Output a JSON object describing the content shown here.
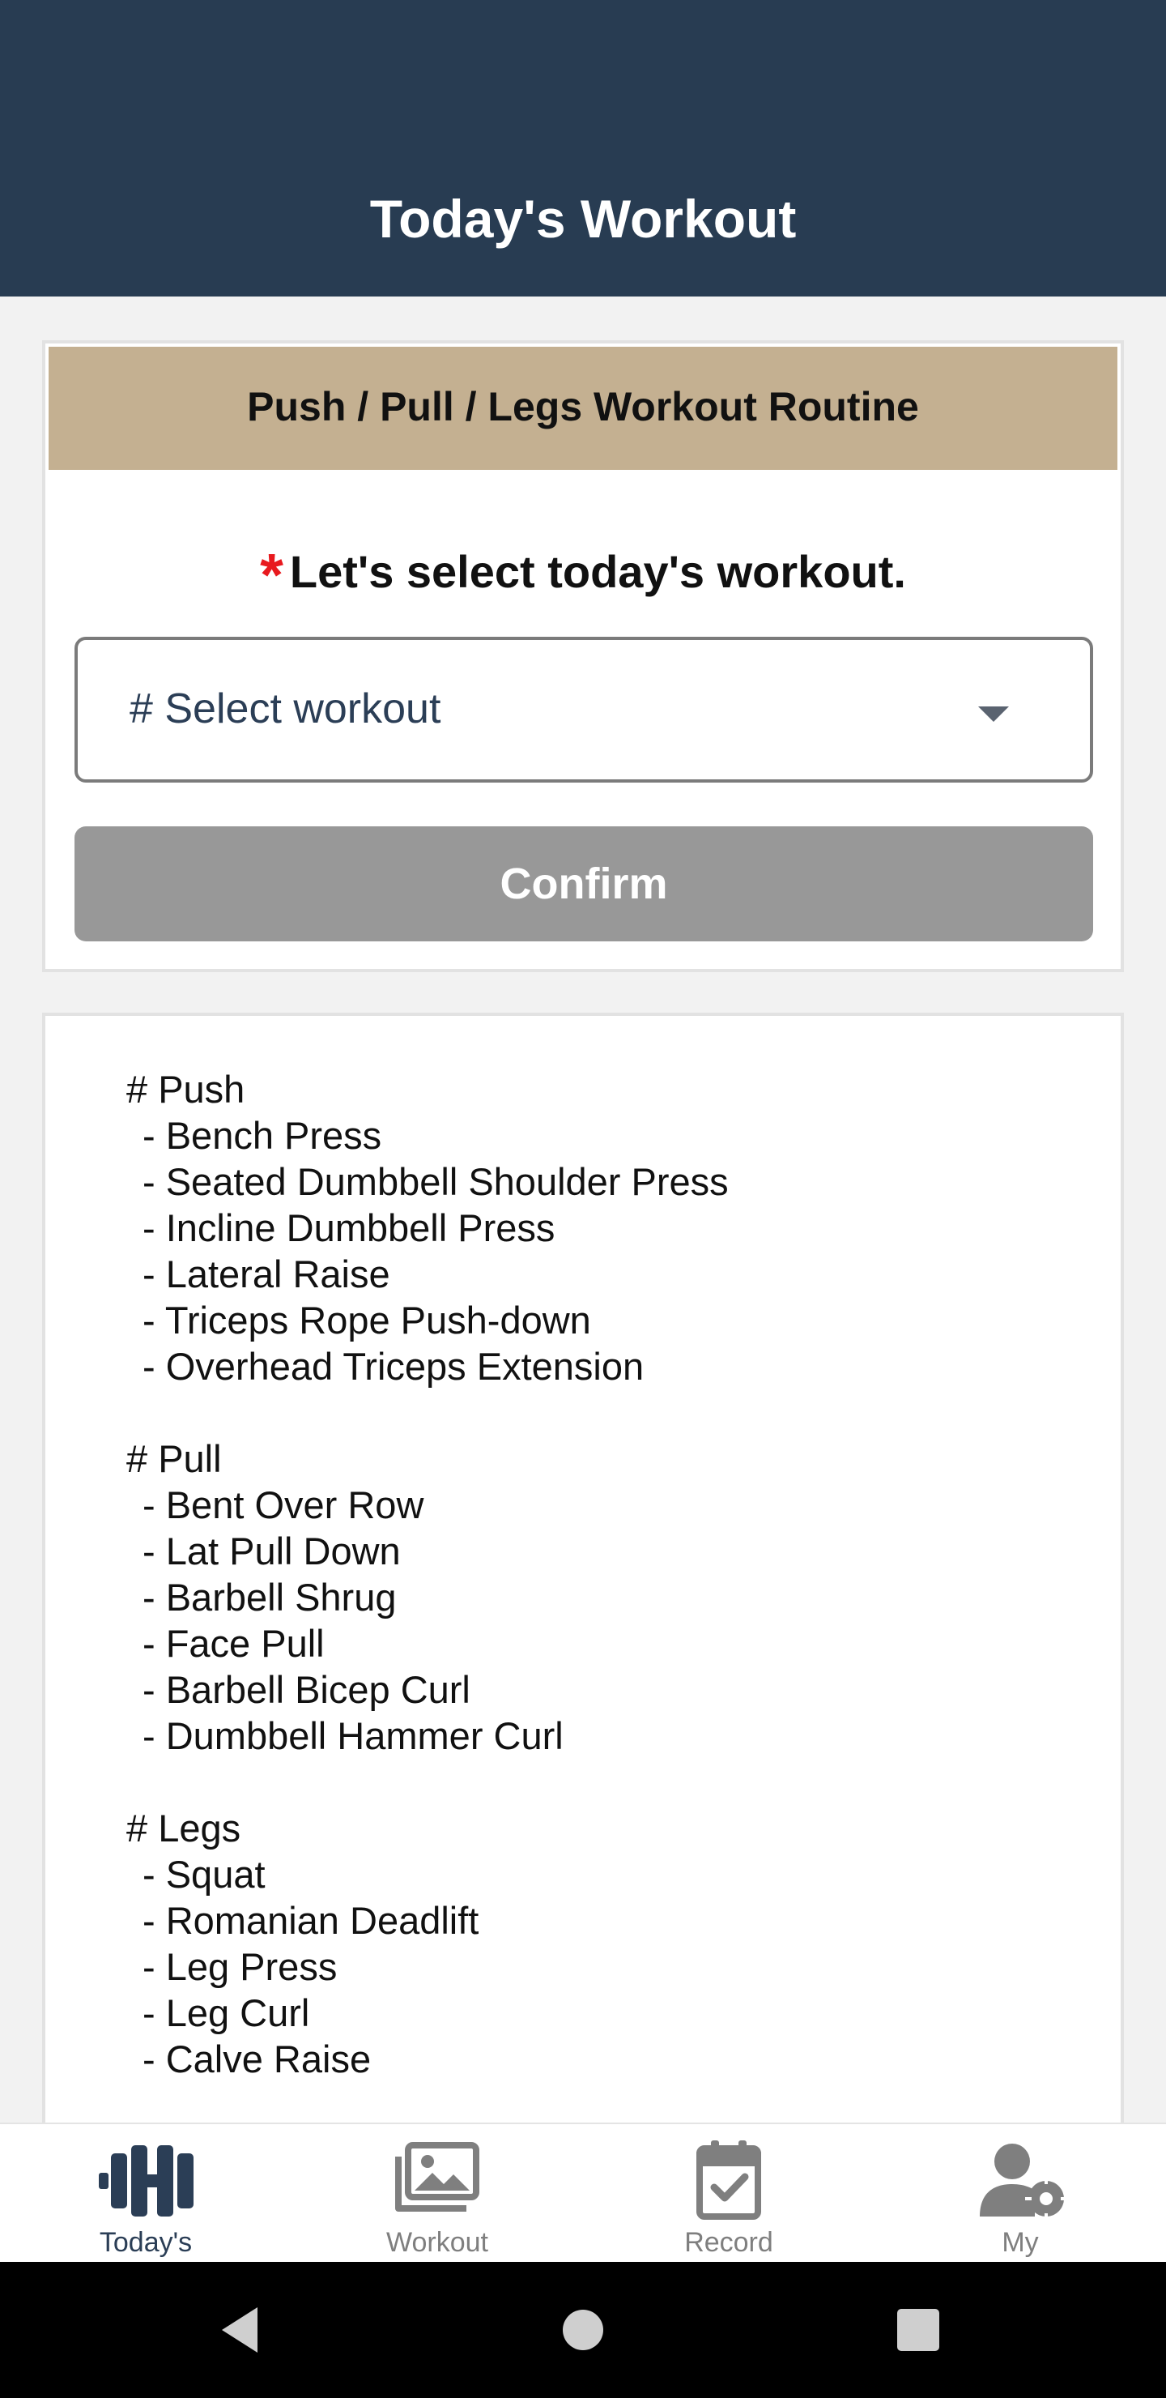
{
  "header": {
    "title": "Today's Workout"
  },
  "routine_card": {
    "title": "Push / Pull / Legs Workout Routine",
    "required_marker": "*",
    "prompt": "Let's select today's workout.",
    "select": {
      "value": "# Select workout"
    },
    "confirm_label": "Confirm"
  },
  "routine_list": {
    "groups": [
      {
        "heading": "# Push",
        "exercises": [
          "- Bench Press",
          "- Seated Dumbbell Shoulder Press",
          "- Incline Dumbbell Press",
          "- Lateral Raise",
          "- Triceps Rope Push-down",
          "- Overhead Triceps Extension"
        ]
      },
      {
        "heading": "# Pull",
        "exercises": [
          "- Bent Over Row",
          "- Lat Pull Down",
          "- Barbell Shrug",
          "- Face Pull",
          "- Barbell Bicep Curl",
          "- Dumbbell Hammer Curl"
        ]
      },
      {
        "heading": "# Legs",
        "exercises": [
          "- Squat",
          "- Romanian Deadlift",
          "- Leg Press",
          "- Leg Curl",
          "- Calve Raise"
        ]
      }
    ]
  },
  "bottom_nav": {
    "items": [
      {
        "label": "Today's",
        "icon": "dumbbell-icon",
        "active": true
      },
      {
        "label": "Workout",
        "icon": "photo-gallery-icon",
        "active": false
      },
      {
        "label": "Record",
        "icon": "calendar-check-icon",
        "active": false
      },
      {
        "label": "My",
        "icon": "user-settings-icon",
        "active": false
      }
    ]
  },
  "colors": {
    "header_bg": "#283c52",
    "card_header_bg": "#c4b091",
    "required_red": "#e8191e",
    "confirm_disabled": "#989898",
    "nav_active": "#2b3e56",
    "nav_inactive": "#7f7f7f"
  }
}
